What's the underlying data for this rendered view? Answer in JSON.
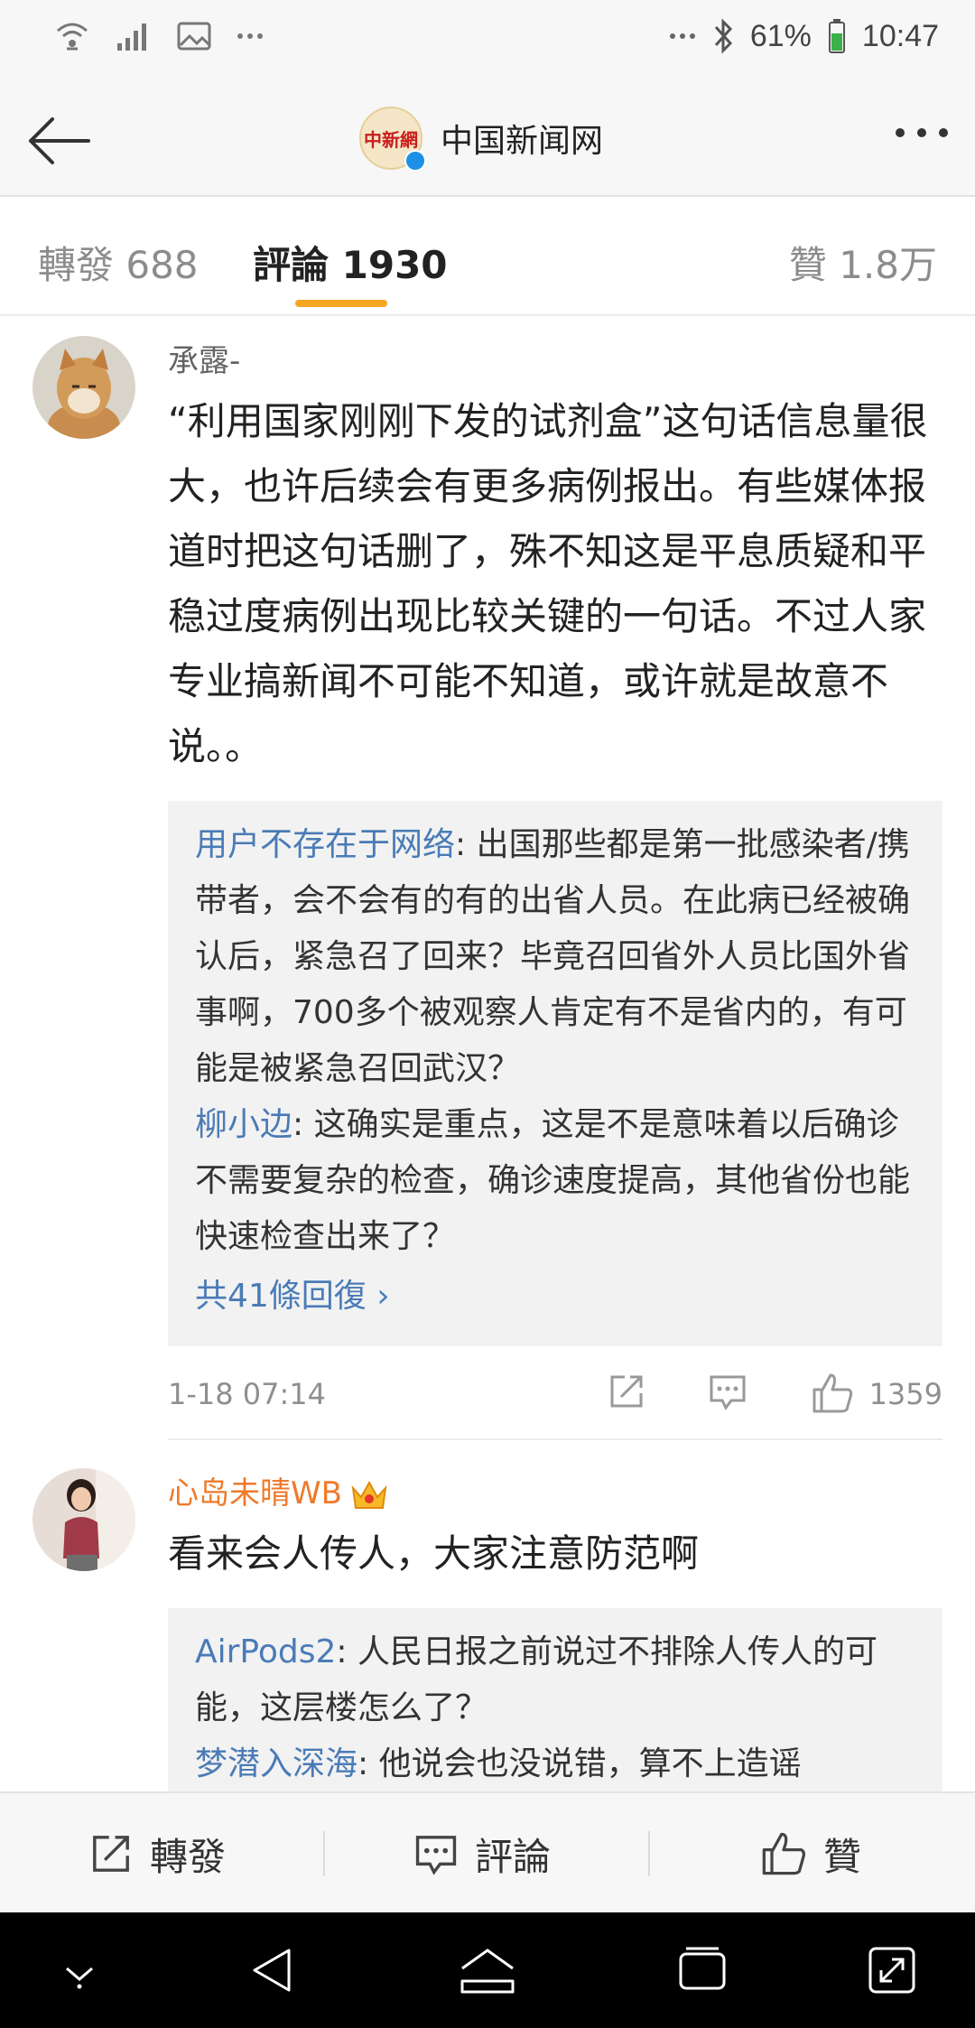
{
  "status_bar": {
    "battery": "61%",
    "time": "10:47",
    "icons": [
      "wifi-icon",
      "signal-icon",
      "image-icon",
      "more-dots-icon",
      "bluetooth-icon",
      "battery-icon"
    ]
  },
  "nav": {
    "title": "中国新闻网",
    "logo_text": "中新網"
  },
  "tabs": {
    "repost": "轉發 688",
    "comment": "評論 1930",
    "like": "贊 1.8万"
  },
  "comments": [
    {
      "user": "承露-",
      "text": "“利用国家刚刚下发的试剂盒”这句话信息量很大，也许后续会有更多病例报出。有些媒体报道时把这句话删了，殊不知这是平息质疑和平稳过度病例出现比较关键的一句话。不过人家专业搞新闻不可能不知道，或许就是故意不说。。",
      "replies": [
        {
          "name": "用户不存在于网络",
          "text": ": 出国那些都是第一批感染者/携带者，会不会有的有的出省人员。在此病已经被确认后，紧急召了回来？毕竟召回省外人员比国外省事啊，700多个被观察人肯定有不是省内的，有可能是被紧急召回武汉？"
        },
        {
          "name": "柳小边",
          "text": ": 这确实是重点，这是不是意味着以后确诊不需要复杂的检查，确诊速度提高，其他省份也能快速检查出来了？"
        }
      ],
      "more_replies": "共41條回復",
      "time": "1-18 07:14",
      "likes": "1359"
    },
    {
      "user": "心岛未晴WB",
      "text": "看来会人传人，大家注意防范啊",
      "replies": [
        {
          "name": "AirPods2",
          "text": ": 人民日报之前说过不排除人传人的可能，这层楼怎么了？"
        },
        {
          "name": "梦潜入深海",
          "text": ": 他说会也没说错，算不上造谣"
        }
      ]
    }
  ],
  "actions": {
    "repost": "轉發",
    "comment": "評論",
    "like": "贊"
  },
  "colors": {
    "accent": "#f5a623",
    "link": "#4a7bb6",
    "vip_name": "#ee7a2b"
  }
}
